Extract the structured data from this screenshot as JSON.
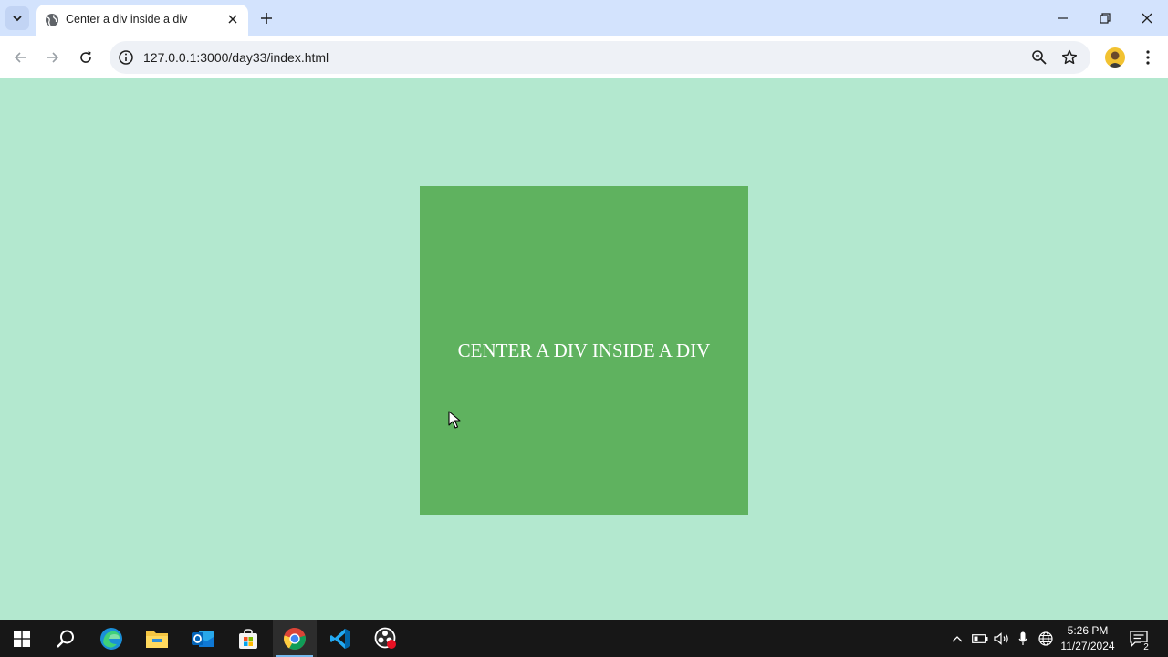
{
  "browser": {
    "tab": {
      "title": "Center a div inside a div",
      "favicon": "globe-icon"
    },
    "new_tab_icon": "plus-icon",
    "address": "127.0.0.1:3000/day33/index.html",
    "toolbar_icons": [
      "back-arrow-icon",
      "forward-arrow-icon",
      "reload-icon",
      "info-icon",
      "zoom-icon",
      "star-icon",
      "profile-avatar",
      "more-vert-icon"
    ],
    "window_controls": [
      "minimize-icon",
      "restore-icon",
      "close-icon"
    ]
  },
  "page": {
    "background_color": "#b3e8cf",
    "box_color": "#5fb25f",
    "box_text": "CENTER A DIV INSIDE A DIV"
  },
  "taskbar": {
    "apps": [
      "windows-start-icon",
      "search-icon",
      "edge-icon",
      "file-explorer-icon",
      "outlook-icon",
      "store-icon",
      "chrome-icon",
      "vscode-icon",
      "obs-icon"
    ],
    "active_app": "chrome-icon",
    "tray_icons": [
      "chevron-up-icon",
      "battery-icon",
      "speaker-icon",
      "microphone-icon",
      "globe-icon"
    ],
    "clock": {
      "time": "5:26 PM",
      "date": "11/27/2024"
    },
    "notifications": {
      "count": "2"
    }
  }
}
